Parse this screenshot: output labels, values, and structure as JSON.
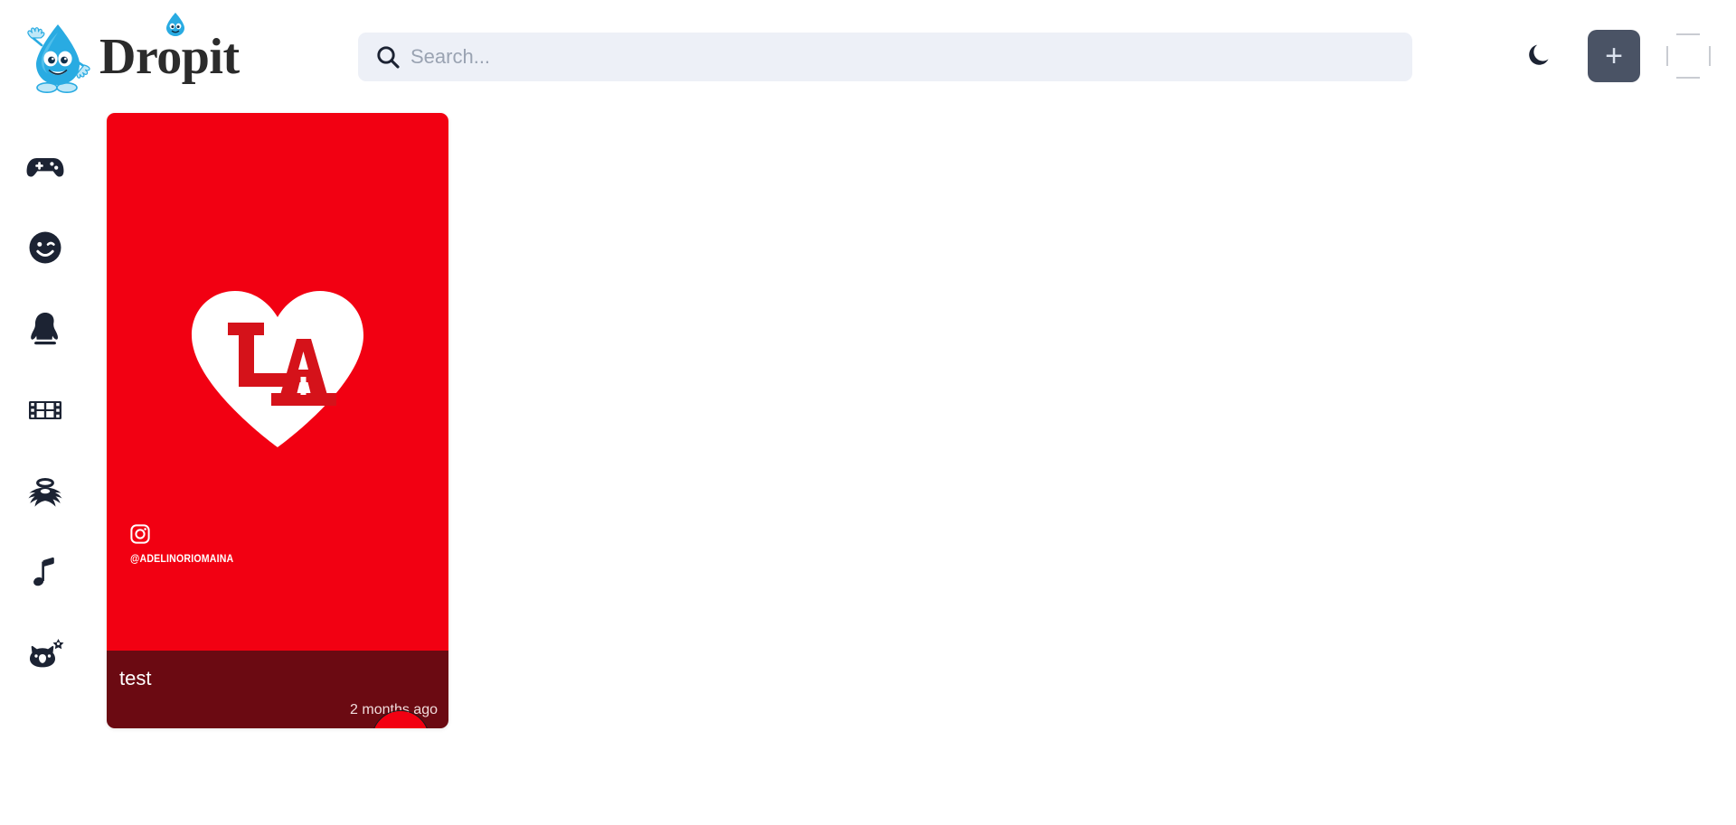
{
  "app": {
    "name": "Dropit",
    "logo_icon": "water-drop-mascot-icon"
  },
  "header": {
    "search": {
      "placeholder": "Search...",
      "value": "",
      "icon": "search-icon"
    },
    "actions": [
      {
        "name": "theme-toggle",
        "icon": "moon-icon",
        "label": ""
      },
      {
        "name": "add-post",
        "icon": "plus-icon",
        "label": "+"
      },
      {
        "name": "user-avatar",
        "icon": "broken-image-icon",
        "label": ""
      }
    ]
  },
  "sidebar": {
    "items": [
      {
        "icon": "gamepad-icon",
        "label": "Games"
      },
      {
        "icon": "wink-face-icon",
        "label": "Emoji"
      },
      {
        "icon": "penguin-icon",
        "label": "QQ"
      },
      {
        "icon": "film-strip-icon",
        "label": "Video"
      },
      {
        "icon": "angel-icon",
        "label": "Angel"
      },
      {
        "icon": "music-note-icon",
        "label": "Music"
      },
      {
        "icon": "cat-sparkle-icon",
        "label": "Cute"
      }
    ]
  },
  "main": {
    "cards": [
      {
        "title": "test",
        "timestamp": "2 months ago",
        "media": {
          "background_color": "#F20012",
          "heart_color": "#FFFFFF",
          "monogram": "LA",
          "monogram_color": "#D5121A",
          "watermark": {
            "icon": "instagram-icon",
            "handle": "@ADELINORIOMAINA"
          }
        },
        "footer_color": "#6B0A12",
        "avatar_icon": "post-avatar-icon"
      }
    ]
  },
  "colors": {
    "accent_red": "#F20012",
    "footer_maroon": "#6B0A12",
    "search_bg": "#EDF0F7",
    "icon_dark": "#1C2333",
    "add_button_bg": "#4A5365"
  }
}
